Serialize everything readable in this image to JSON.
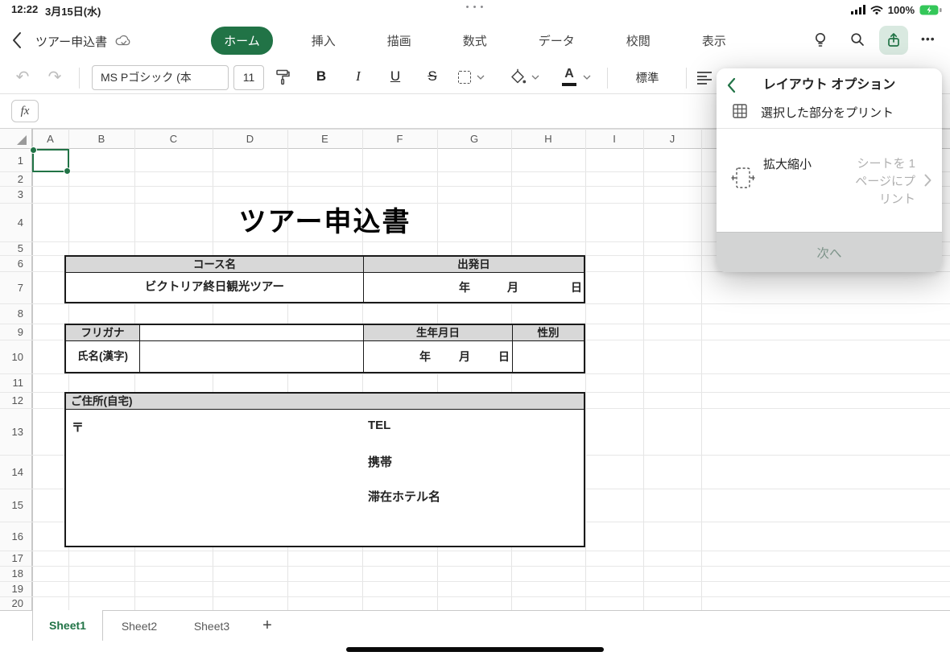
{
  "status": {
    "time": "12:22",
    "date": "3月15日(水)",
    "battery_pct": "100%"
  },
  "icons": {
    "undo": "↶",
    "redo": "↷",
    "multitask_dots": "• • •",
    "ellipsis": "•••"
  },
  "titlebar": {
    "doc_title": "ツアー申込書",
    "tabs": [
      {
        "label": "ホーム",
        "active": true
      },
      {
        "label": "挿入",
        "active": false
      },
      {
        "label": "描画",
        "active": false
      },
      {
        "label": "数式",
        "active": false
      },
      {
        "label": "データ",
        "active": false
      },
      {
        "label": "校閲",
        "active": false
      },
      {
        "label": "表示",
        "active": false
      }
    ]
  },
  "toolbar": {
    "font_name": "MS Pゴシック (本",
    "font_size": "11",
    "bold": "B",
    "italic": "I",
    "underline": "U",
    "strike": "S",
    "font_color_letter": "A",
    "number_format": "標準"
  },
  "formula_bar": {
    "label": "fx"
  },
  "grid": {
    "col_headers": [
      "A",
      "B",
      "C",
      "D",
      "E",
      "F",
      "G",
      "H",
      "I",
      "J"
    ],
    "row_headers": [
      "1",
      "2",
      "3",
      "4",
      "5",
      "6",
      "7",
      "8",
      "9",
      "10",
      "11",
      "12",
      "13",
      "14",
      "15",
      "16",
      "17",
      "18",
      "19",
      "20"
    ]
  },
  "sheet": {
    "title": "ツアー申込書",
    "course_table": {
      "course_header": "コース名",
      "departure_header": "出発日",
      "course_name": "ビクトリア終日観光ツアー",
      "year": "年",
      "month": "月",
      "day": "日"
    },
    "name_table": {
      "furigana": "フリガナ",
      "birthdate": "生年月日",
      "gender": "性別",
      "name": "氏名(漢字)",
      "year": "年",
      "month": "月",
      "day": "日"
    },
    "address_table": {
      "header": "ご住所(自宅)",
      "postal_mark": "〒",
      "tel": "TEL",
      "mobile": "携帯",
      "hotel": "滞在ホテル名"
    }
  },
  "panel": {
    "title": "レイアウト オプション",
    "print_selection": "選択した部分をプリント",
    "scale_label": "拡大縮小",
    "scale_value_lines": [
      "シートを 1",
      "ページにプ",
      "リント"
    ],
    "next_label": "次へ"
  },
  "sheet_tabs": {
    "tabs": [
      {
        "label": "Sheet1",
        "active": true
      },
      {
        "label": "Sheet2",
        "active": false
      },
      {
        "label": "Sheet3",
        "active": false
      }
    ],
    "add": "+"
  },
  "colors": {
    "excel_green": "#217346",
    "table_header_fill": "#d8d8d8",
    "share_selected_bg": "#d9e9e0"
  }
}
